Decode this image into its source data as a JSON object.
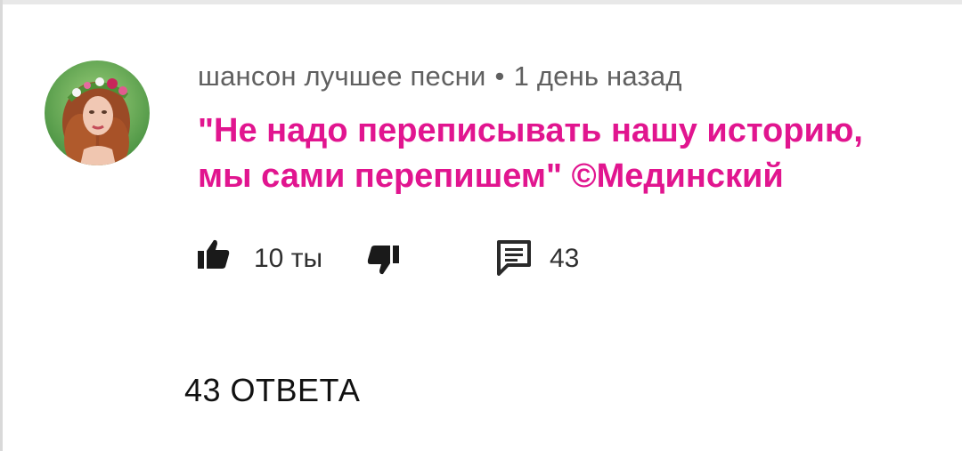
{
  "comment": {
    "author": "шансон лучшее песни",
    "separator": "•",
    "timestamp": "1 день назад",
    "text_lines": [
      "\"Не надо переписывать нашу историю,",
      "мы сами перепишем\" ©Мединский"
    ],
    "accent_color": "#e1158f",
    "likes": "10 ты",
    "replies_count": "43",
    "replies_toggle": "43 ОТВЕТА"
  },
  "icons": {
    "like": "thumbs-up-icon",
    "dislike": "thumbs-down-icon",
    "reply": "comment-icon"
  }
}
